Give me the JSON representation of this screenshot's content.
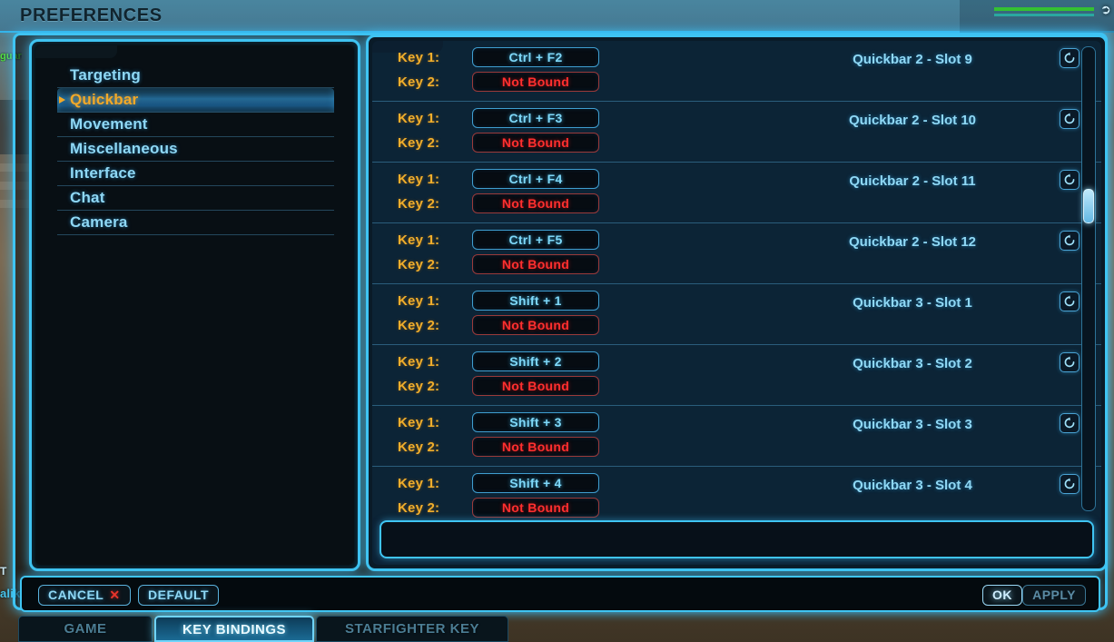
{
  "window": {
    "title": "PREFERENCES"
  },
  "background": {
    "nameplate_line1": "T",
    "nameplate_line2": "alik",
    "hud_text": "guard"
  },
  "sidebar": {
    "items": [
      {
        "label": "Targeting",
        "selected": false
      },
      {
        "label": "Quickbar",
        "selected": true
      },
      {
        "label": "Movement",
        "selected": false
      },
      {
        "label": "Miscellaneous",
        "selected": false
      },
      {
        "label": "Interface",
        "selected": false
      },
      {
        "label": "Chat",
        "selected": false
      },
      {
        "label": "Camera",
        "selected": false
      }
    ]
  },
  "bindings": {
    "key1_label": "Key 1:",
    "key2_label": "Key 2:",
    "unbound_text": "Not Bound",
    "reset_icon": "reset-arrow-icon",
    "rows": [
      {
        "name": "",
        "key1": "",
        "key2": "",
        "partial_top": true
      },
      {
        "name": "Quickbar 2 - Slot 9",
        "key1": "Ctrl + F2",
        "key2": "Not Bound"
      },
      {
        "name": "Quickbar 2 - Slot 10",
        "key1": "Ctrl + F3",
        "key2": "Not Bound"
      },
      {
        "name": "Quickbar 2 - Slot 11",
        "key1": "Ctrl + F4",
        "key2": "Not Bound"
      },
      {
        "name": "Quickbar 2 - Slot 12",
        "key1": "Ctrl + F5",
        "key2": "Not Bound"
      },
      {
        "name": "Quickbar 3 - Slot 1",
        "key1": "Shift + 1",
        "key2": "Not Bound"
      },
      {
        "name": "Quickbar 3 - Slot 2",
        "key1": "Shift + 2",
        "key2": "Not Bound"
      },
      {
        "name": "Quickbar 3 - Slot 3",
        "key1": "Shift + 3",
        "key2": "Not Bound"
      },
      {
        "name": "Quickbar 3 - Slot 4",
        "key1": "Shift + 4",
        "key2": "Not Bound"
      }
    ]
  },
  "scrollbar": {
    "thumb_position_percent": 33
  },
  "actions": {
    "cancel_label": "CANCEL",
    "cancel_glyph": "✕",
    "default_label": "DEFAULT",
    "ok_label": "OK",
    "apply_label": "APPLY"
  },
  "tabs": [
    {
      "label": "GAME",
      "active": false
    },
    {
      "label": "KEY BINDINGS",
      "active": true
    },
    {
      "label": "STARFIGHTER KEY BINDINGS",
      "active": false
    }
  ],
  "colors": {
    "frame_cyan": "#3fc4f2",
    "text_cyan": "#8fd8f5",
    "selected_gold": "#f2a928",
    "key_label_gold": "#f0ae2c",
    "unbound_red": "#ff2f2f",
    "panel_dark": "#0c2436",
    "left_panel_dark": "#080f14"
  }
}
